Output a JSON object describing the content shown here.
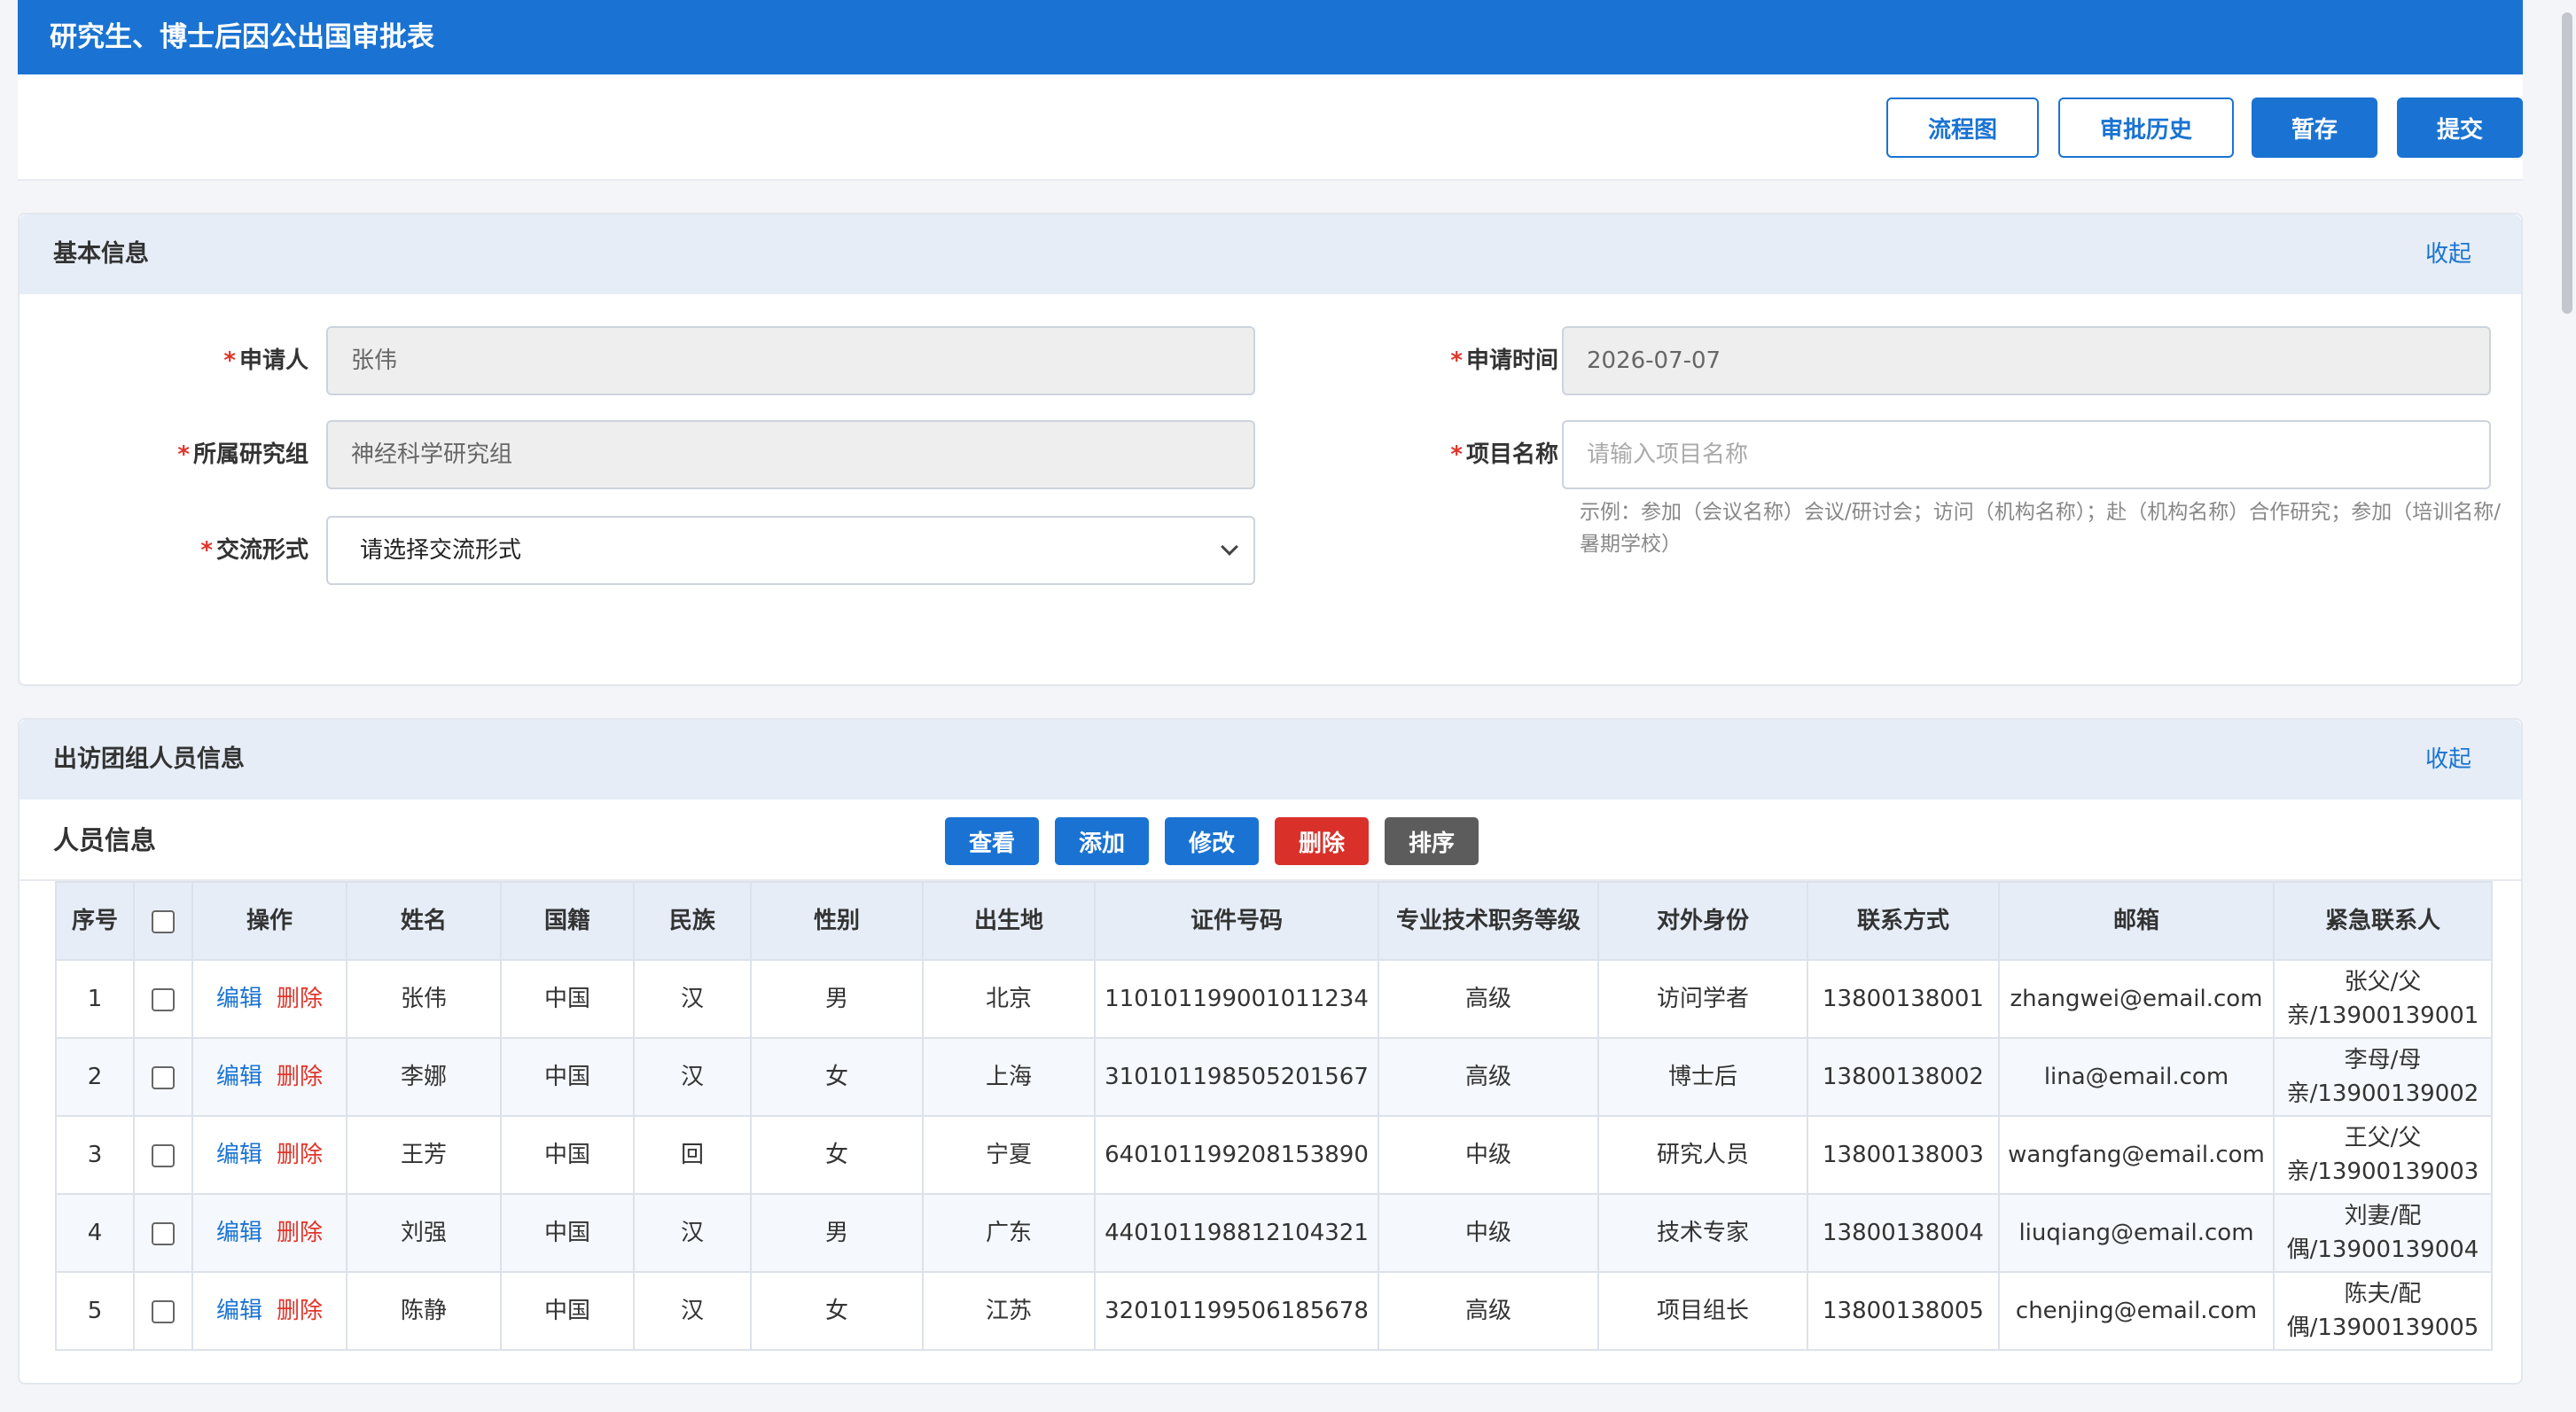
{
  "title": "研究生、博士后因公出国审批表",
  "toolbar": {
    "flow": "流程图",
    "history": "审批历史",
    "save": "暂存",
    "submit": "提交"
  },
  "basic": {
    "title": "基本信息",
    "collapse": "收起",
    "applicant_label": "申请人",
    "applicant_value": "张伟",
    "date_label": "申请时间",
    "date_value": "2026-07-07",
    "group_label": "所属研究组",
    "group_value": "神经科学研究组",
    "project_label": "项目名称",
    "project_placeholder": "请输入项目名称",
    "form_label": "交流形式",
    "form_value": "请选择交流形式",
    "hint": "示例：参加（会议名称）会议/研讨会；访问（机构名称）；赴（机构名称）合作研究；参加（培训名称/暑期学校）"
  },
  "members": {
    "title": "出访团组人员信息",
    "collapse": "收起",
    "subtitle": "人员信息",
    "buttons": {
      "view": "查看",
      "add": "添加",
      "modify": "修改",
      "delete": "删除",
      "sort": "排序"
    },
    "headers": [
      "序号",
      "",
      "操作",
      "姓名",
      "国籍",
      "民族",
      "性别",
      "出生地",
      "证件号码",
      "专业技术职务等级",
      "对外身份",
      "联系方式",
      "邮箱",
      "紧急联系人"
    ],
    "edit_label": "编辑",
    "delete_label": "删除",
    "rows": [
      {
        "no": "1",
        "name": "张伟",
        "nationality": "中国",
        "ethnicity": "汉",
        "gender": "男",
        "birthplace": "北京",
        "id": "110101199001011234",
        "rank": "高级",
        "identity": "访问学者",
        "phone": "13800138001",
        "email": "zhangwei@email.com",
        "emergency": "张父/父亲/13900139001"
      },
      {
        "no": "2",
        "name": "李娜",
        "nationality": "中国",
        "ethnicity": "汉",
        "gender": "女",
        "birthplace": "上海",
        "id": "310101198505201567",
        "rank": "高级",
        "identity": "博士后",
        "phone": "13800138002",
        "email": "lina@email.com",
        "emergency": "李母/母亲/13900139002"
      },
      {
        "no": "3",
        "name": "王芳",
        "nationality": "中国",
        "ethnicity": "回",
        "gender": "女",
        "birthplace": "宁夏",
        "id": "640101199208153890",
        "rank": "中级",
        "identity": "研究人员",
        "phone": "13800138003",
        "email": "wangfang@email.com",
        "emergency": "王父/父亲/13900139003"
      },
      {
        "no": "4",
        "name": "刘强",
        "nationality": "中国",
        "ethnicity": "汉",
        "gender": "男",
        "birthplace": "广东",
        "id": "440101198812104321",
        "rank": "中级",
        "identity": "技术专家",
        "phone": "13800138004",
        "email": "liuqiang@email.com",
        "emergency": "刘妻/配偶/13900139004"
      },
      {
        "no": "5",
        "name": "陈静",
        "nationality": "中国",
        "ethnicity": "汉",
        "gender": "女",
        "birthplace": "江苏",
        "id": "320101199506185678",
        "rank": "高级",
        "identity": "项目组长",
        "phone": "13800138005",
        "email": "chenjing@email.com",
        "emergency": "陈夫/配偶/13900139005"
      }
    ]
  },
  "colors": {
    "primary": "#1a73d2",
    "danger": "#d9302a",
    "neutral": "#5c5c5c"
  }
}
